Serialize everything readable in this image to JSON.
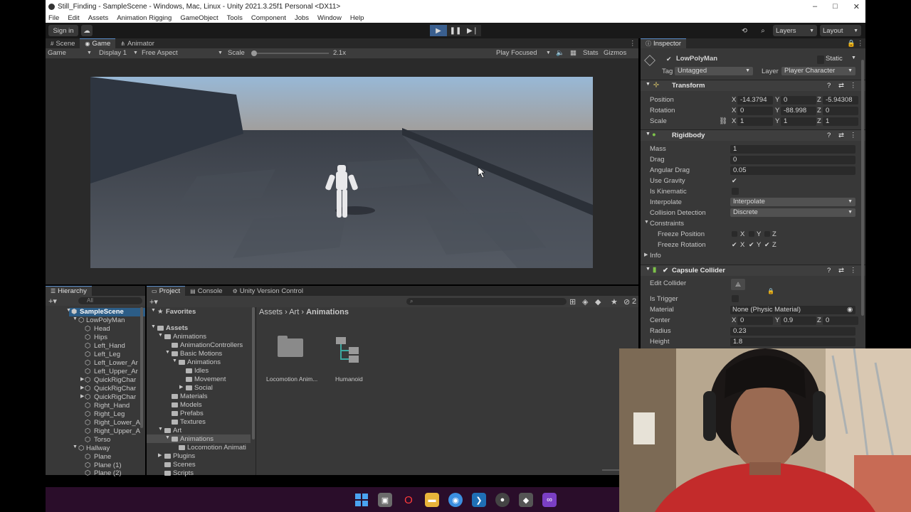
{
  "window": {
    "title": "Still_Finding - SampleScene - Windows, Mac, Linux - Unity 2021.3.25f1 Personal <DX11>",
    "minimize": "–",
    "maximize": "□",
    "close": "✕"
  },
  "menu": [
    "File",
    "Edit",
    "Assets",
    "Animation Rigging",
    "GameObject",
    "Tools",
    "Component",
    "Jobs",
    "Window",
    "Help"
  ],
  "toolbar": {
    "sign_in": "Sign in",
    "layers": "Layers",
    "layout": "Layout"
  },
  "game_panel": {
    "tabs": [
      "Scene",
      "Game",
      "Animator"
    ],
    "active_tab": "Game",
    "mode": "Game",
    "display": "Display 1",
    "aspect": "Free Aspect",
    "scale_label": "Scale",
    "scale_value": "2.1x",
    "play_focused": "Play Focused",
    "stats": "Stats",
    "gizmos": "Gizmos"
  },
  "inspector": {
    "tab": "Inspector",
    "object_name": "LowPolyMan",
    "static_label": "Static",
    "tag_label": "Tag",
    "tag_value": "Untagged",
    "layer_label": "Layer",
    "layer_value": "Player Character",
    "transform": {
      "title": "Transform",
      "position_label": "Position",
      "rotation_label": "Rotation",
      "scale_label": "Scale",
      "position": {
        "x": "-14.3794",
        "y": "0",
        "z": "-5.94308"
      },
      "rotation": {
        "x": "0",
        "y": "-88.998",
        "z": "0"
      },
      "scale": {
        "x": "1",
        "y": "1",
        "z": "1"
      }
    },
    "rigidbody": {
      "title": "Rigidbody",
      "mass_label": "Mass",
      "mass": "1",
      "drag_label": "Drag",
      "drag": "0",
      "angular_drag_label": "Angular Drag",
      "angular_drag": "0.05",
      "use_gravity_label": "Use Gravity",
      "is_kinematic_label": "Is Kinematic",
      "interpolate_label": "Interpolate",
      "interpolate": "Interpolate",
      "collision_label": "Collision Detection",
      "collision": "Discrete",
      "constraints_label": "Constraints",
      "freeze_position_label": "Freeze Position",
      "freeze_rotation_label": "Freeze Rotation",
      "info_label": "Info"
    },
    "capsule": {
      "title": "Capsule Collider",
      "edit_collider_label": "Edit Collider",
      "is_trigger_label": "Is Trigger",
      "material_label": "Material",
      "material": "None (Physic Material)",
      "center_label": "Center",
      "center": {
        "x": "0",
        "y": "0.9",
        "z": "0"
      },
      "radius_label": "Radius",
      "radius": "0.23",
      "height_label": "Height",
      "height": "1.8"
    }
  },
  "hierarchy": {
    "tab": "Hierarchy",
    "search_placeholder": "All",
    "items": [
      "SampleScene",
      "LowPolyMan",
      "Head",
      "Hips",
      "Left_Hand",
      "Left_Leg",
      "Left_Lower_Ar",
      "Left_Upper_Ar",
      "QuickRigChar",
      "QuickRigChar",
      "QuickRigChar",
      "Right_Hand",
      "Right_Leg",
      "Right_Lower_A",
      "Right_Upper_A",
      "Torso",
      "Hallway",
      "Plane",
      "Plane (1)",
      "Plane (2)"
    ]
  },
  "project": {
    "tabs": [
      "Project",
      "Console",
      "Unity Version Control"
    ],
    "favorites": "Favorites",
    "tree": [
      "Assets",
      "Animations",
      "AnimationControllers",
      "Basic Motions",
      "Animations",
      "Idles",
      "Movement",
      "Social",
      "Materials",
      "Models",
      "Prefabs",
      "Textures",
      "Art",
      "Animations",
      "Locomotion Animati",
      "Plugins",
      "Scenes",
      "Scripts"
    ],
    "breadcrumb": [
      "Assets",
      "Art",
      "Animations"
    ],
    "assets": [
      "Locomotion Anim...",
      "Humanoid"
    ],
    "count": "2"
  },
  "colors": {
    "accent": "#5a8cc8",
    "taskbar": "#2a0d2a",
    "editor_bg": "#383838"
  }
}
